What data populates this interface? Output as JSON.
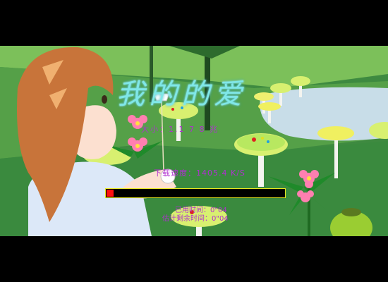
{
  "loader": {
    "title": "我的的爱",
    "size_text": "大小：1.1 7 8 兆",
    "speed_text": "下载速度：1405.4 K/S",
    "elapsed_text": "已用时间：0\"04",
    "remaining_text": "估计剩余时间：0\"04",
    "progress_fraction": 0.04
  },
  "colors": {
    "letterbox": "#000000",
    "progress_border": "#e8e820",
    "progress_fill": "#ff1010",
    "label_text": "#b030d0",
    "title_text": "#7fe8e8"
  }
}
